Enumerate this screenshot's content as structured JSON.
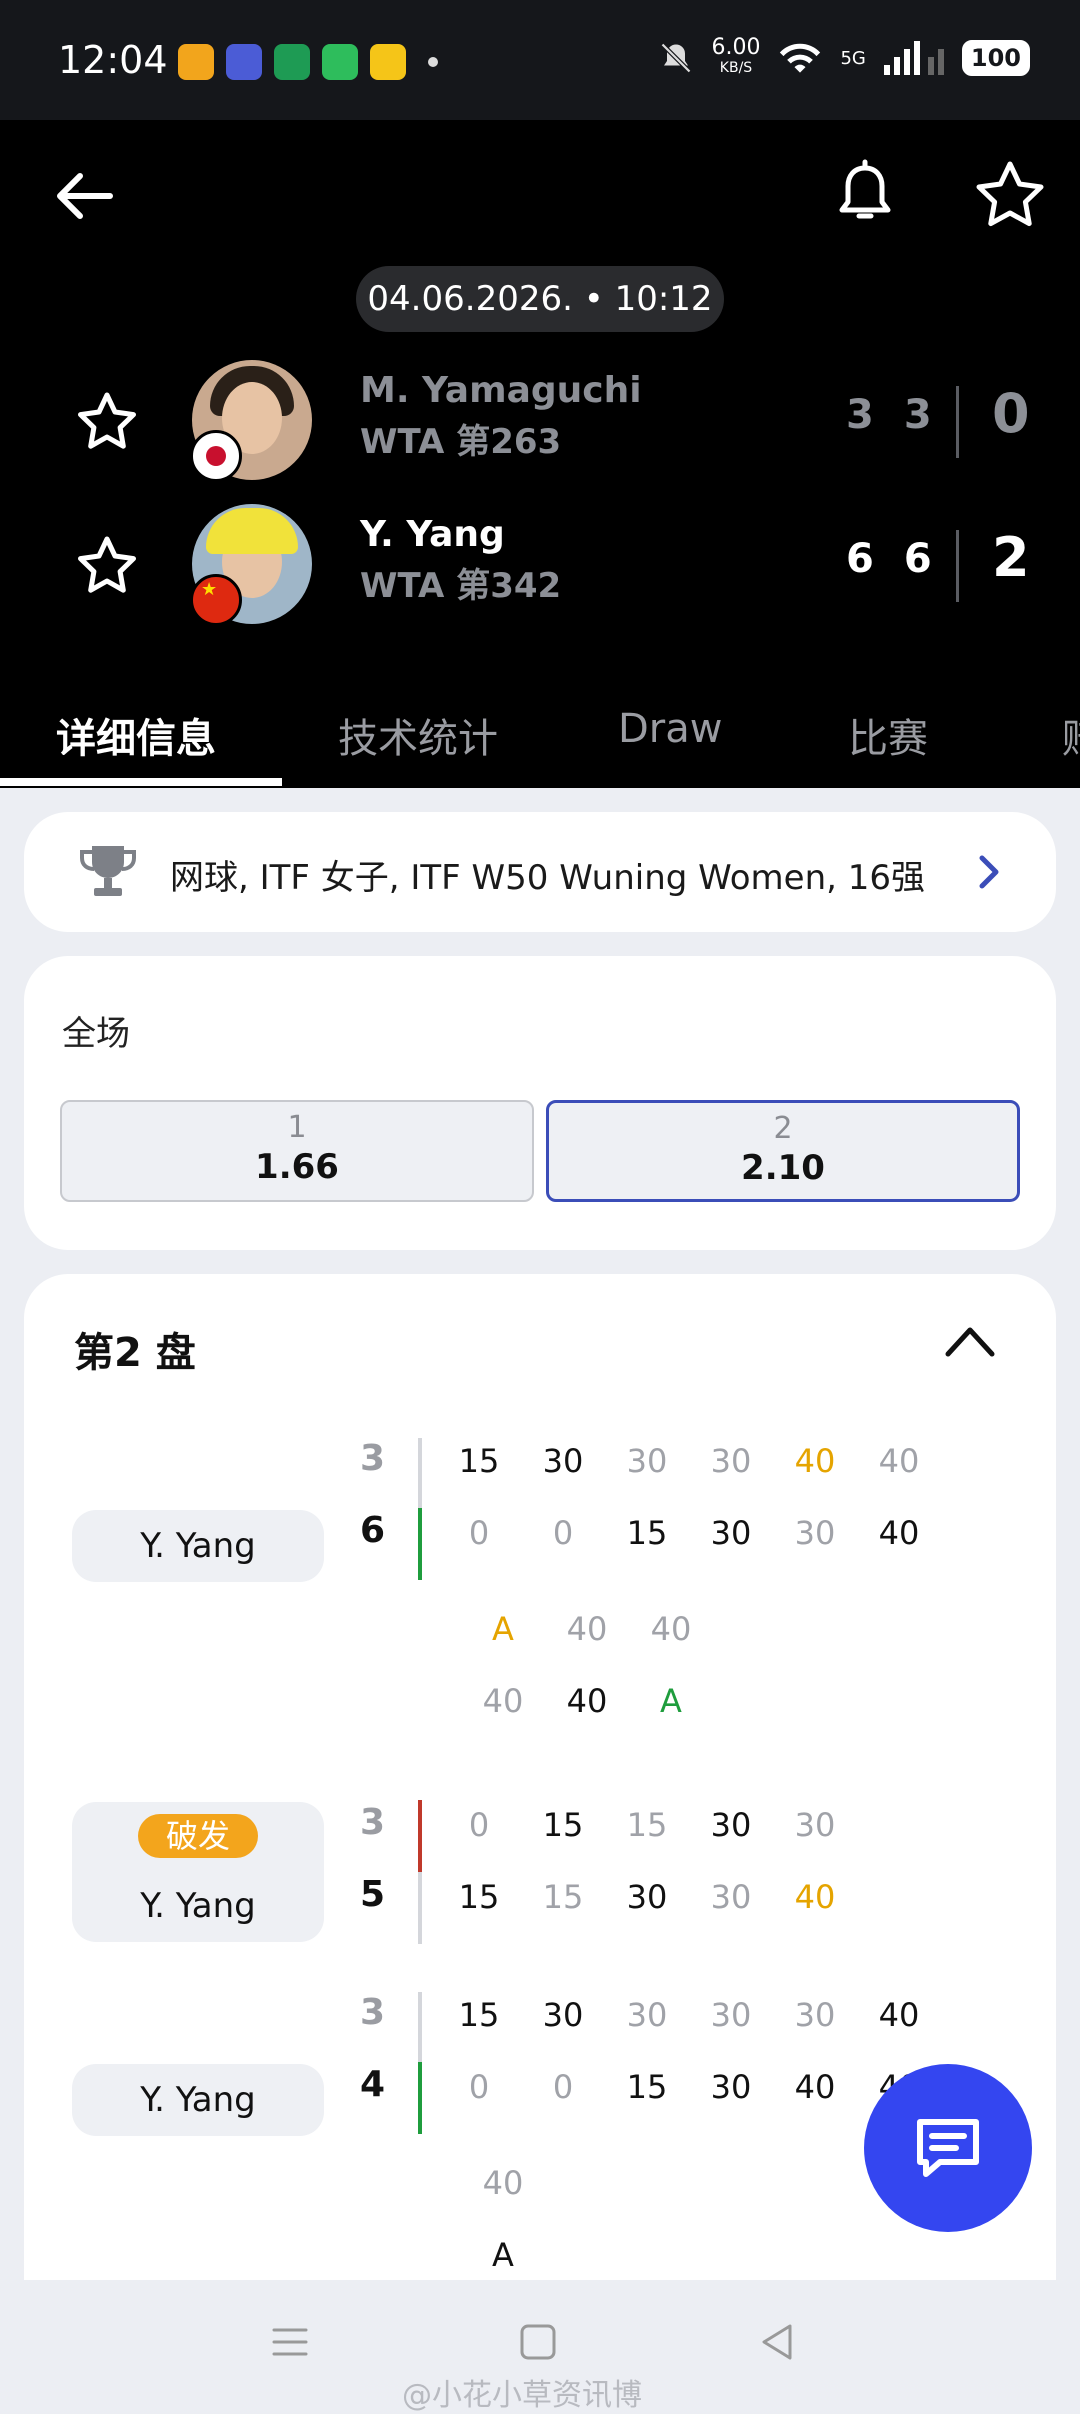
{
  "status_bar": {
    "time": "12:04",
    "net_speed": "6.00",
    "net_unit": "KB/S",
    "signal": "5G",
    "battery": "100"
  },
  "match": {
    "datetime": "04.06.2026. • 10:12",
    "players": [
      {
        "name": "M. Yamaguchi",
        "rank": "WTA 第263",
        "sets": [
          "3",
          "3"
        ],
        "total": "0",
        "flag": "japan-flag"
      },
      {
        "name": "Y. Yang",
        "rank": "WTA 第342",
        "sets": [
          "6",
          "6"
        ],
        "total": "2",
        "flag": "china-flag"
      }
    ]
  },
  "tabs": [
    "详细信息",
    "技术统计",
    "Draw",
    "比赛",
    "赔"
  ],
  "league": {
    "text": "网球, ITF 女子, ITF W50 Wuning Women, 16强"
  },
  "odds": {
    "title": "全场",
    "options": [
      {
        "label": "1",
        "value": "1.66"
      },
      {
        "label": "2",
        "value": "2.10"
      }
    ]
  },
  "set_section": {
    "title": "第2 盘",
    "games": [
      {
        "server": "Y. Yang",
        "badge": "",
        "top_score": "3",
        "bottom_score": "6",
        "top_points": [
          "15",
          "30",
          "30",
          "30",
          "40",
          "40"
        ],
        "bottom_points": [
          "0",
          "0",
          "15",
          "30",
          "30",
          "40"
        ],
        "deuce_top": [
          "A",
          "40",
          "40"
        ],
        "deuce_bottom": [
          "40",
          "40",
          "A"
        ]
      },
      {
        "server": "Y. Yang",
        "badge": "破发",
        "top_score": "3",
        "bottom_score": "5",
        "top_points": [
          "0",
          "15",
          "15",
          "30",
          "30"
        ],
        "bottom_points": [
          "15",
          "15",
          "30",
          "30",
          "40"
        ]
      },
      {
        "server": "Y. Yang",
        "badge": "",
        "top_score": "3",
        "bottom_score": "4",
        "top_points": [
          "15",
          "30",
          "30",
          "30",
          "30",
          "40"
        ],
        "bottom_points": [
          "0",
          "0",
          "15",
          "30",
          "40",
          "40"
        ],
        "deuce_top": [
          "40"
        ],
        "deuce_bottom": [
          "A"
        ]
      }
    ]
  },
  "watermark": "@小花小草资讯博",
  "colors": {
    "header_bg": "#000000",
    "accent_blue": "#3446f0",
    "gold": "#e5a400",
    "green": "#1f9d3d",
    "break_red": "#c0392b"
  }
}
